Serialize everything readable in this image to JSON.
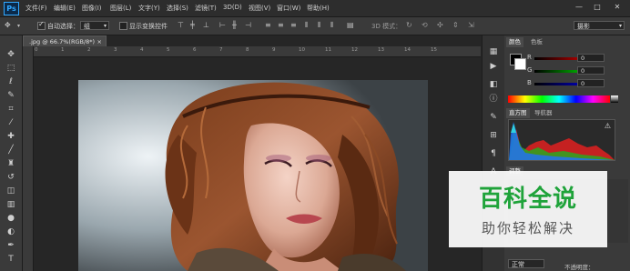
{
  "app": {
    "logo": "Ps"
  },
  "menu": [
    "文件(F)",
    "编辑(E)",
    "图像(I)",
    "图层(L)",
    "文字(Y)",
    "选择(S)",
    "滤镜(T)",
    "3D(D)",
    "视图(V)",
    "窗口(W)",
    "帮助(H)"
  ],
  "window_controls": {
    "minimize": "—",
    "maximize": "□",
    "close": "✕"
  },
  "options": {
    "auto_select_label": "自动选择：",
    "auto_select_value": "组",
    "show_transform_label": "显示变换控件",
    "mode_3d_label": "3D 模式：",
    "workspace": "摄影"
  },
  "document": {
    "tab_title": ".jpg @ 66.7%(RGB/8*)",
    "close": "×"
  },
  "ruler": {
    "ticks": [
      "0",
      "1",
      "2",
      "3",
      "4",
      "5",
      "6",
      "7",
      "8",
      "9",
      "10",
      "11",
      "12",
      "13",
      "14",
      "15"
    ]
  },
  "panels": {
    "color_tab": "颜色",
    "swatches_tab": "色板",
    "r_label": "R",
    "g_label": "G",
    "b_label": "B",
    "r_value": "0",
    "g_value": "0",
    "b_value": "0",
    "histogram_tab": "直方图",
    "navigator_tab": "导航器",
    "histogram_warning": "⚠",
    "adjust_tab": "调整",
    "blend_mode": "正常",
    "opacity_label": "不透明度："
  },
  "watermark": {
    "title": "百科全说",
    "subtitle": "助你轻松解决"
  },
  "colors": {
    "accent": "#31a8ff",
    "watermark_green": "#1fa33a"
  }
}
